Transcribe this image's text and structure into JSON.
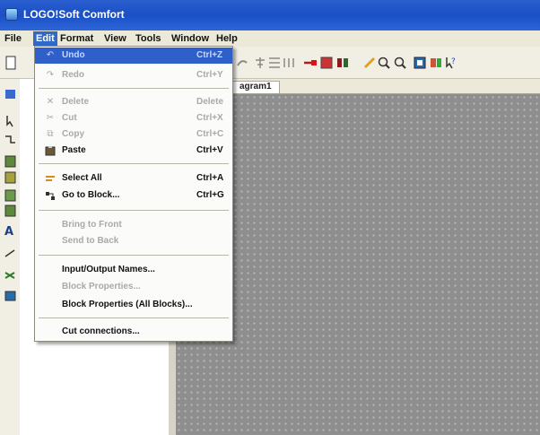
{
  "window": {
    "title": "LOGO!Soft Comfort"
  },
  "menubar": {
    "items": [
      {
        "label": "File"
      },
      {
        "label": "Edit"
      },
      {
        "label": "Format"
      },
      {
        "label": "View"
      },
      {
        "label": "Tools"
      },
      {
        "label": "Window"
      },
      {
        "label": "Help"
      }
    ],
    "active": "Edit"
  },
  "tabs": [
    {
      "label": "agram1"
    }
  ],
  "edit_menu": {
    "items": [
      {
        "label": "Undo",
        "shortcut": "Ctrl+Z",
        "enabled": false,
        "highlighted": true,
        "icon": "undo-icon"
      },
      {
        "label": "Redo",
        "shortcut": "Ctrl+Y",
        "enabled": false,
        "icon": "redo-icon"
      },
      {
        "label": "Delete",
        "shortcut": "Delete",
        "enabled": false,
        "icon": "delete-icon"
      },
      {
        "label": "Cut",
        "shortcut": "Ctrl+X",
        "enabled": false,
        "icon": "cut-icon"
      },
      {
        "label": "Copy",
        "shortcut": "Ctrl+C",
        "enabled": false,
        "icon": "copy-icon"
      },
      {
        "label": "Paste",
        "shortcut": "Ctrl+V",
        "enabled": true,
        "icon": "paste-icon"
      },
      {
        "label": "Select All",
        "shortcut": "Ctrl+A",
        "enabled": true,
        "icon": "select-all-icon"
      },
      {
        "label": "Go to Block...",
        "shortcut": "Ctrl+G",
        "enabled": true,
        "icon": "go-to-block-icon"
      },
      {
        "label": "Bring to Front",
        "shortcut": "",
        "enabled": false
      },
      {
        "label": "Send to Back",
        "shortcut": "",
        "enabled": false
      },
      {
        "label": "Input/Output Names...",
        "shortcut": "",
        "enabled": true
      },
      {
        "label": "Block Properties...",
        "shortcut": "",
        "enabled": false
      },
      {
        "label": "Block Properties (All Blocks)...",
        "shortcut": "",
        "enabled": true
      },
      {
        "label": "Cut connections...",
        "shortcut": "",
        "enabled": true
      }
    ]
  },
  "colors": {
    "titlebar": "#1a4fc6",
    "menu_highlight": "#316ac5",
    "diagram_background": "#8e8e8e"
  }
}
